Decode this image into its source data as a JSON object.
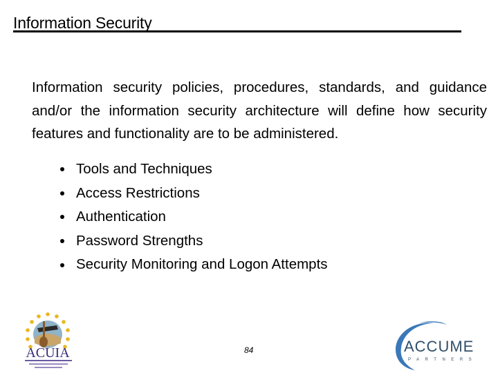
{
  "slide": {
    "title": "Information Security",
    "paragraph": "Information security policies, procedures, standards, and guidance and/or the information security architecture will define how security features and functionality are to be administered.",
    "bullets": [
      "Tools and Techniques",
      "Access Restrictions",
      "Authentication",
      "Password Strengths",
      "Security Monitoring and Logon Attempts"
    ],
    "page_number": "84"
  },
  "logos": {
    "left": {
      "name": "ACUIA",
      "icon": "acuia-logo"
    },
    "right": {
      "name": "ACCUME",
      "subtitle": "PARTNERS",
      "icon": "accume-partners-logo"
    }
  },
  "colors": {
    "accume_blue": "#3a78b8",
    "accume_text": "#2f4f6a",
    "acuia_purple": "#3b2a7a",
    "star_gold": "#e8b820"
  }
}
